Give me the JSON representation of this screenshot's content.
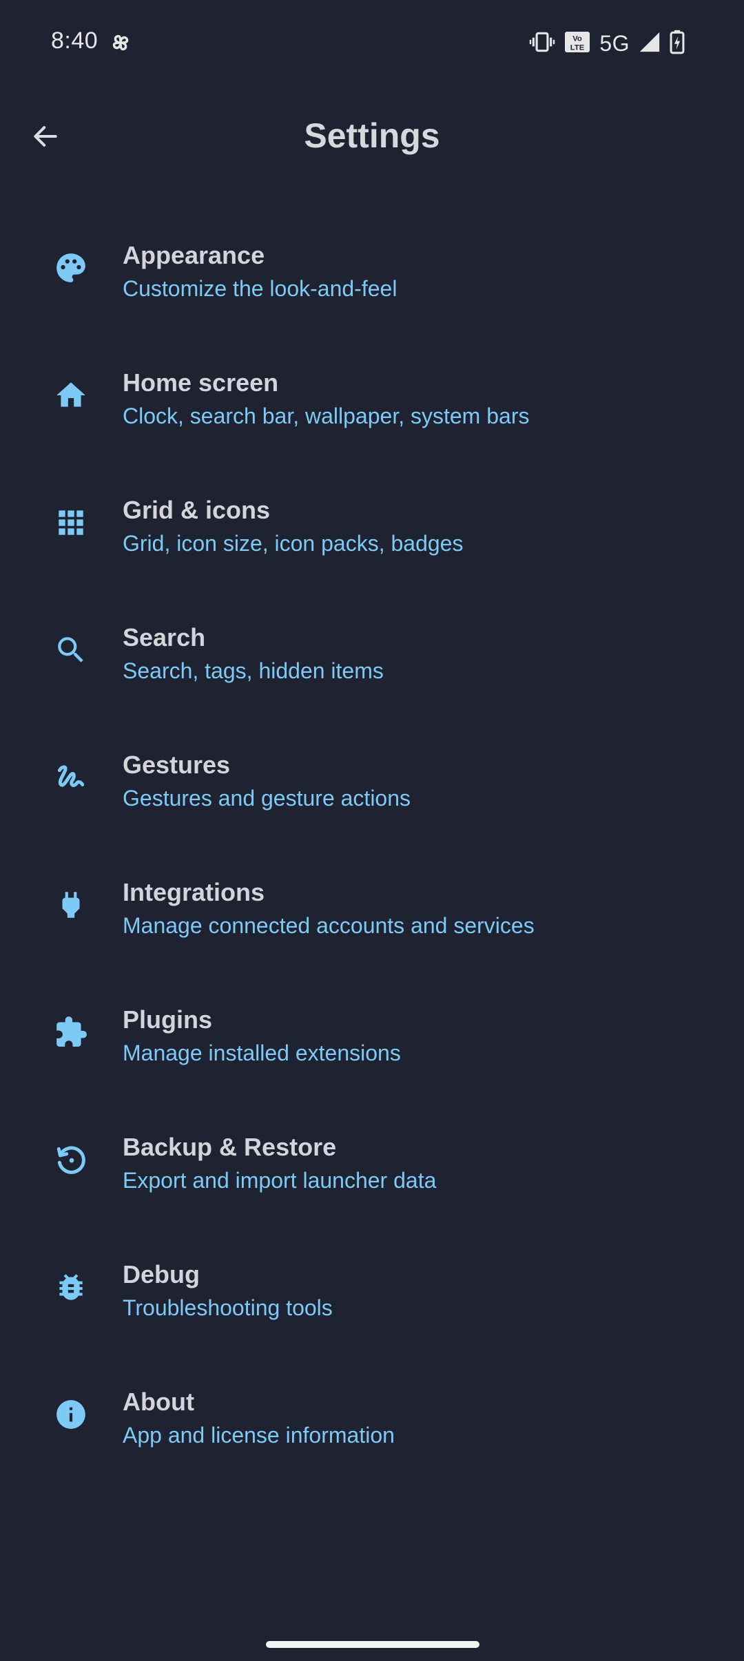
{
  "status_bar": {
    "time": "8:40",
    "network": "5G",
    "icons": [
      "pinwheel-icon",
      "vibrate-icon",
      "volte-icon",
      "signal-icon",
      "battery-charging-icon"
    ]
  },
  "app_bar": {
    "title": "Settings",
    "back_icon": "arrow-back-icon"
  },
  "colors": {
    "background": "#1F2230",
    "accent": "#7CCAF5",
    "title_text": "#D3D5DB"
  },
  "settings": {
    "items": [
      {
        "title": "Appearance",
        "subtitle": "Customize the look-and-feel",
        "icon": "palette-icon"
      },
      {
        "title": "Home screen",
        "subtitle": "Clock, search bar, wallpaper, system bars",
        "icon": "home-icon"
      },
      {
        "title": "Grid & icons",
        "subtitle": "Grid, icon size, icon packs, badges",
        "icon": "apps-grid-icon"
      },
      {
        "title": "Search",
        "subtitle": "Search, tags, hidden items",
        "icon": "search-icon"
      },
      {
        "title": "Gestures",
        "subtitle": "Gestures and gesture actions",
        "icon": "gesture-icon"
      },
      {
        "title": "Integrations",
        "subtitle": "Manage connected accounts and services",
        "icon": "plug-icon"
      },
      {
        "title": "Plugins",
        "subtitle": "Manage installed extensions",
        "icon": "puzzle-icon"
      },
      {
        "title": "Backup & Restore",
        "subtitle": "Export and import launcher data",
        "icon": "restore-icon"
      },
      {
        "title": "Debug",
        "subtitle": "Troubleshooting tools",
        "icon": "bug-icon"
      },
      {
        "title": "About",
        "subtitle": "App and license information",
        "icon": "info-icon"
      }
    ]
  }
}
